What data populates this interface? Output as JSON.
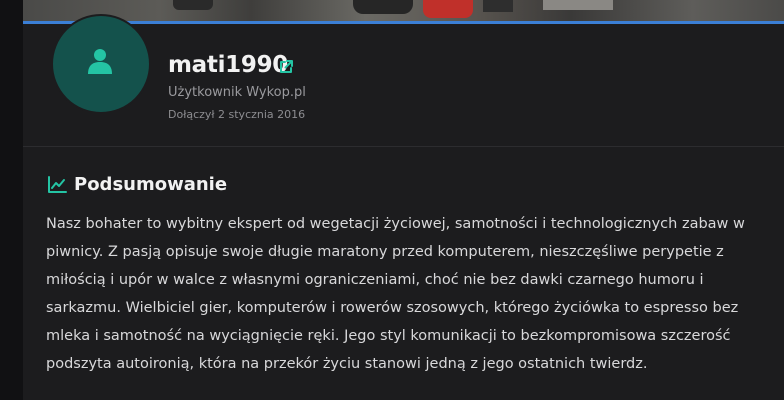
{
  "profile": {
    "username": "mati1990",
    "role": "Użytkownik Wykop.pl",
    "joined": "Dołączył 2 stycznia 2016"
  },
  "summary": {
    "title": "Podsumowanie",
    "text": "Nasz bohater to wybitny ekspert od wegetacji życiowej, samotności i technologicznych zabaw w piwnicy. Z pasją opisuje swoje długie maratony przed komputerem, nieszczęśliwe perypetie z miłością i upór w walce z własnymi ograniczeniami, choć nie bez dawki czarnego humoru i sarkazmu. Wielbiciel gier, komputerów i rowerów szosowych, którego życiówka to espresso bez mleka i samotność na wyciągnięcie ręki. Jego styl komunikacji to bezkompromisowa szczerość podszyta autoironią, która na przekór życiu stanowi jedną z jego ostatnich twierdz."
  },
  "icons": {
    "avatar": "user-silhouette-icon",
    "external_link": "external-link-icon",
    "summary": "trend-chart-icon"
  },
  "colors": {
    "accent": "#24c4a4",
    "avatar_bg": "#14524c",
    "cover_bar": "#3b7fd6",
    "background": "#1c1c1e"
  }
}
